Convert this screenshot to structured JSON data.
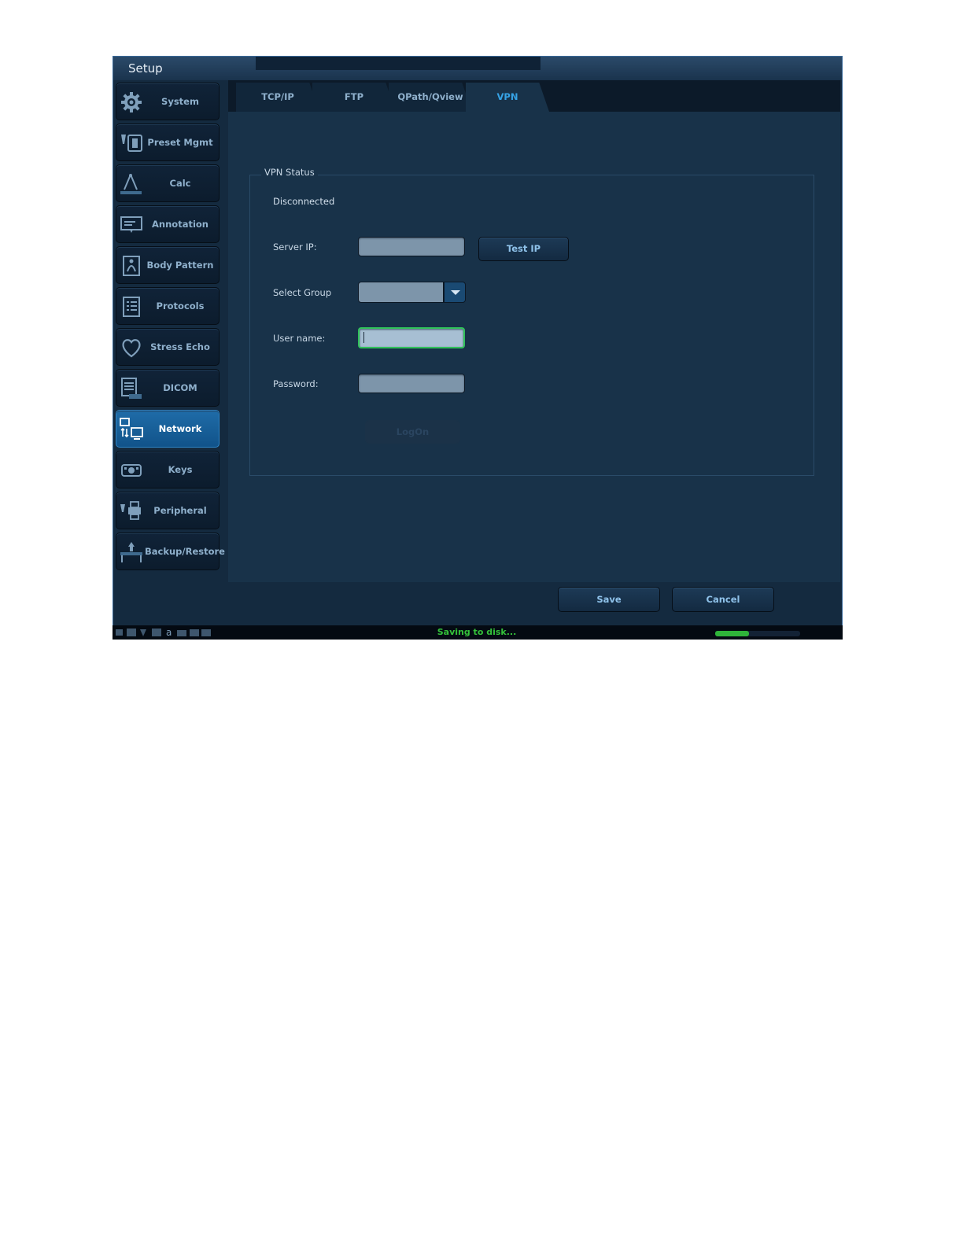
{
  "window": {
    "title": "Setup"
  },
  "sidebar": {
    "items": [
      {
        "label": "System",
        "icon": "gear-icon"
      },
      {
        "label": "Preset Mgmt",
        "icon": "probe-preset-icon"
      },
      {
        "label": "Calc",
        "icon": "compass-icon"
      },
      {
        "label": "Annotation",
        "icon": "comment-icon"
      },
      {
        "label": "Body Pattern",
        "icon": "body-pattern-icon"
      },
      {
        "label": "Protocols",
        "icon": "list-icon"
      },
      {
        "label": "Stress Echo",
        "icon": "heart-icon"
      },
      {
        "label": "DICOM",
        "icon": "document-icon"
      },
      {
        "label": "Network",
        "icon": "network-icon",
        "active": true
      },
      {
        "label": "Keys",
        "icon": "keys-icon"
      },
      {
        "label": "Peripheral",
        "icon": "printer-icon"
      },
      {
        "label": "Backup/Restore",
        "icon": "backup-icon"
      }
    ]
  },
  "tabs": [
    {
      "label": "TCP/IP"
    },
    {
      "label": "FTP"
    },
    {
      "label": "QPath/Qview"
    },
    {
      "label": "VPN",
      "active": true
    }
  ],
  "vpn": {
    "group_title": "VPN Status",
    "status": "Disconnected",
    "server_ip_label": "Server IP:",
    "server_ip_value": "",
    "test_ip_label": "Test IP",
    "select_group_label": "Select Group",
    "select_group_value": "",
    "username_label": "User name:",
    "username_value": "",
    "password_label": "Password:",
    "password_value": "",
    "logon_label": "LogOn"
  },
  "footer": {
    "save_label": "Save",
    "cancel_label": "Cancel"
  },
  "statusbar": {
    "message": "Saving to disk...",
    "progress": 0.4
  },
  "colors": {
    "accent": "#36a3e6",
    "active_nav": "#1f6ca8",
    "status_green": "#34c23a",
    "focus_border": "#30c25a"
  }
}
